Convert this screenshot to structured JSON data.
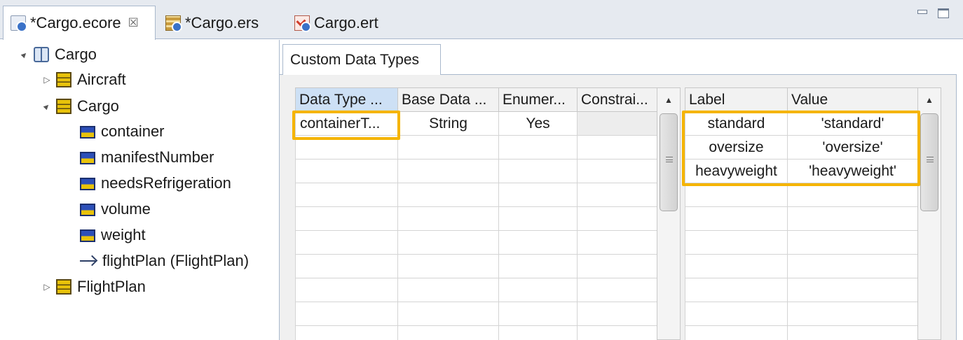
{
  "tabs": [
    {
      "label": "*Cargo.ecore",
      "icon": "ecore-file-icon",
      "active": true,
      "close": "☒"
    },
    {
      "label": "*Cargo.ers",
      "icon": "ers-file-icon",
      "active": false
    },
    {
      "label": "Cargo.ert",
      "icon": "ert-file-icon",
      "active": false
    }
  ],
  "tree": [
    {
      "label": "Cargo",
      "icon": "package-icon",
      "twisty": "▲",
      "level": 0
    },
    {
      "label": "Aircraft",
      "icon": "class-icon",
      "twisty": "▷",
      "level": 1
    },
    {
      "label": "Cargo",
      "icon": "class-icon",
      "twisty": "▲",
      "level": 1
    },
    {
      "label": "container",
      "icon": "attribute-icon",
      "level": 2
    },
    {
      "label": "manifestNumber",
      "icon": "attribute-icon",
      "level": 2
    },
    {
      "label": "needsRefrigeration",
      "icon": "attribute-icon",
      "level": 2
    },
    {
      "label": "volume",
      "icon": "attribute-icon",
      "level": 2
    },
    {
      "label": "weight",
      "icon": "attribute-icon",
      "level": 2
    },
    {
      "label": "flightPlan (FlightPlan)",
      "icon": "reference-icon",
      "level": 2
    },
    {
      "label": "FlightPlan",
      "icon": "class-icon",
      "twisty": "▷",
      "level": 1
    }
  ],
  "editor": {
    "section_tab": "Custom Data Types",
    "types_table": {
      "headers": [
        "Data Type ...",
        "Base Data ...",
        "Enumer...",
        "Constrai..."
      ],
      "rows": [
        [
          "containerT...",
          "String",
          "Yes",
          ""
        ]
      ]
    },
    "literals_table": {
      "headers": [
        "Label",
        "Value"
      ],
      "rows": [
        [
          "standard",
          "'standard'"
        ],
        [
          "oversize",
          "'oversize'"
        ],
        [
          "heavyweight",
          "'heavyweight'"
        ]
      ]
    },
    "highlight_color": "#f5b400"
  }
}
